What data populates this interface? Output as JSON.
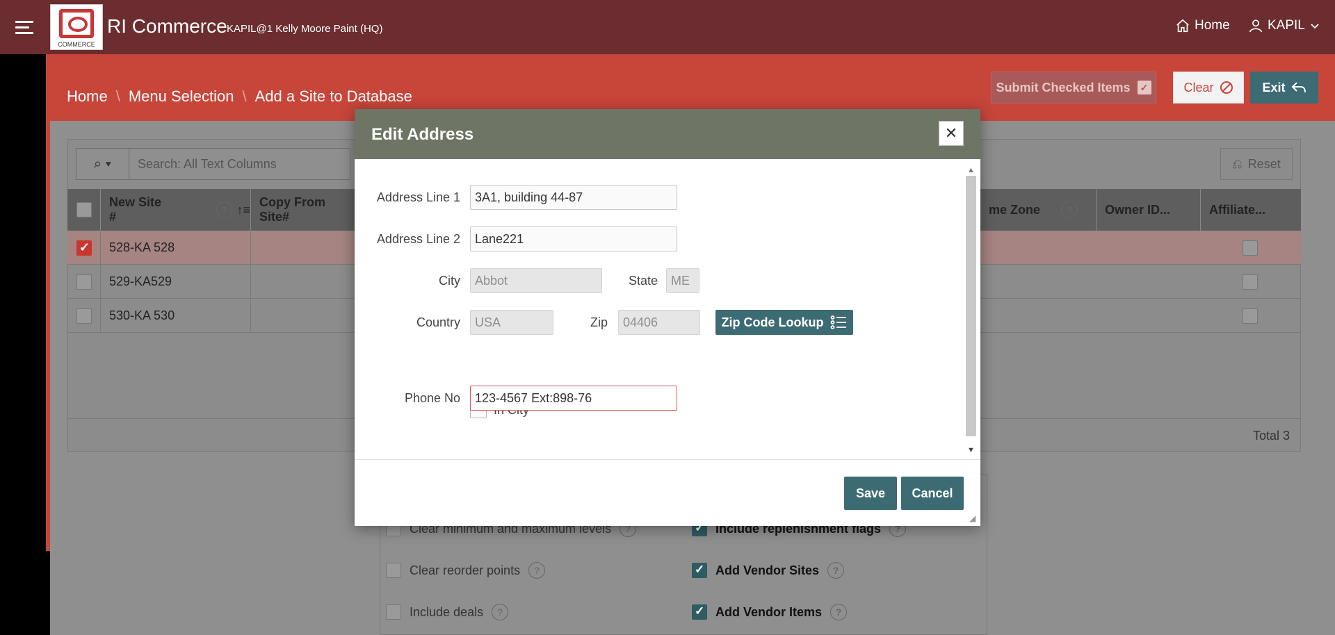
{
  "header": {
    "app_title": "RI Commerce",
    "app_subtitle": "KAPIL@1 Kelly Moore Paint (HQ)",
    "logo_caption": "COMMERCE",
    "home_label": "Home",
    "user_label": "KAPIL"
  },
  "breadcrumb": {
    "items": [
      "Home",
      "Menu Selection",
      "Add a Site to Database"
    ]
  },
  "toolbar": {
    "submit_label": "Submit Checked Items",
    "clear_label": "Clear",
    "exit_label": "Exit",
    "reset_label": "Reset"
  },
  "search": {
    "placeholder": "Search: All Text Columns"
  },
  "grid": {
    "columns": [
      "New Site #",
      "Copy From Site#",
      "me Zone",
      "Owner ID...",
      "Affiliate..."
    ],
    "rows": [
      {
        "site": "528-KA 528",
        "checked": true
      },
      {
        "site": "529-KA529",
        "checked": false
      },
      {
        "site": "530-KA 530",
        "checked": false
      }
    ],
    "total": "Total 3"
  },
  "options": {
    "left": [
      "Clear minimum and maximum levels",
      "Clear reorder points",
      "Include deals"
    ],
    "right": [
      "Include replenishment flags",
      "Add Vendor Sites",
      "Add Vendor Items"
    ]
  },
  "dialog": {
    "title": "Edit Address",
    "labels": {
      "address1": "Address Line 1",
      "address2": "Address Line 2",
      "city": "City",
      "state": "State",
      "country": "Country",
      "zip": "Zip",
      "in_city": "In City",
      "phone": "Phone No"
    },
    "values": {
      "address1": "3A1, building 44-87",
      "address2": "Lane221",
      "city": "Abbot",
      "state": "ME",
      "country": "USA",
      "zip": "04406",
      "phone": "123-4567 Ext:898-76"
    },
    "zip_lookup_label": "Zip Code Lookup",
    "save_label": "Save",
    "cancel_label": "Cancel"
  },
  "colors": {
    "header_bg": "#6b2d2f",
    "band_bg": "#c8453a",
    "dialog_header": "#6e7565",
    "button_teal": "#3d6b74"
  }
}
